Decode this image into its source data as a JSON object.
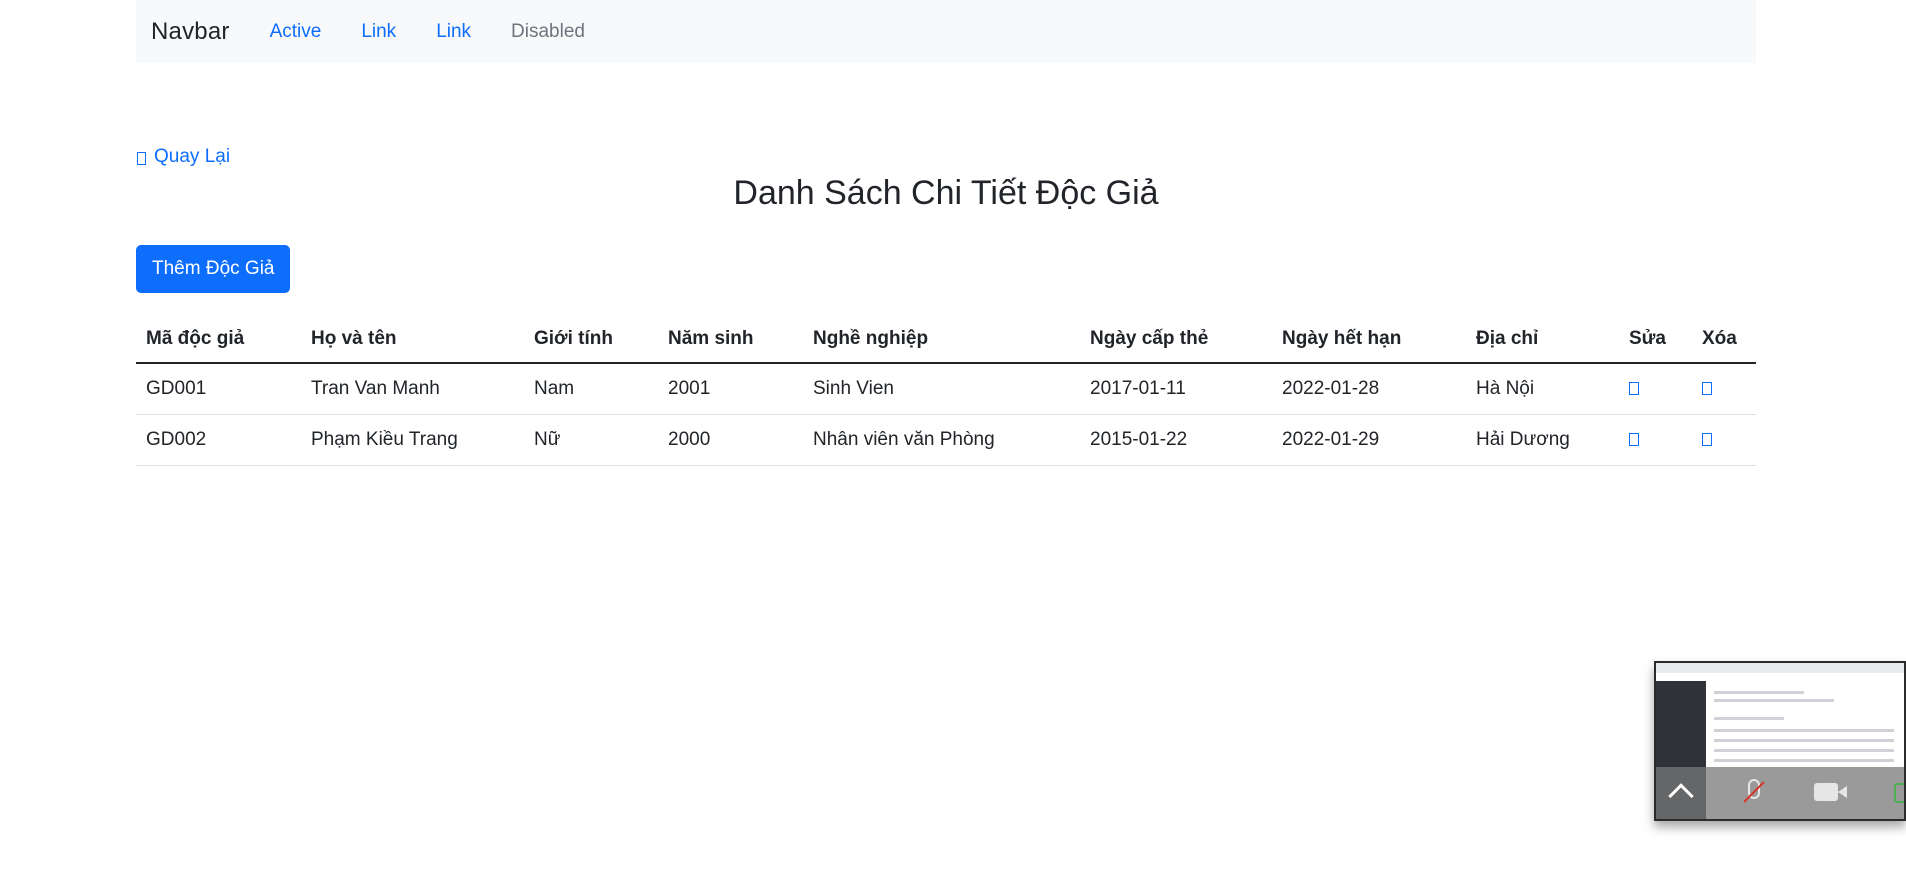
{
  "navbar": {
    "brand": "Navbar",
    "links": [
      {
        "label": "Active"
      },
      {
        "label": "Link"
      },
      {
        "label": "Link"
      },
      {
        "label": "Disabled"
      }
    ]
  },
  "back_link": {
    "label": "Quay Lại",
    "icon": "arrow-left-icon"
  },
  "page_title": "Danh Sách Chi Tiết Độc Giả",
  "add_button": {
    "label": "Thêm Độc Giả"
  },
  "table": {
    "headers": [
      "Mã độc giả",
      "Họ và tên",
      "Giới tính",
      "Năm sinh",
      "Nghề nghiệp",
      "Ngày cấp thẻ",
      "Ngày hết hạn",
      "Địa chỉ",
      "Sửa",
      "Xóa"
    ],
    "rows": [
      {
        "id": "GD001",
        "name": "Tran Van Manh",
        "gender": "Nam",
        "birth_year": "2001",
        "occupation": "Sinh Vien",
        "issue_date": "2017-01-11",
        "expiry_date": "2022-01-28",
        "address": "Hà Nội",
        "edit_icon": "edit-icon",
        "delete_icon": "delete-icon"
      },
      {
        "id": "GD002",
        "name": "Phạm Kiều Trang",
        "gender": "Nữ",
        "birth_year": "2000",
        "occupation": "Nhân viên văn Phòng",
        "issue_date": "2015-01-22",
        "expiry_date": "2022-01-29",
        "address": "Hải Dương",
        "edit_icon": "edit-icon",
        "delete_icon": "delete-icon"
      }
    ]
  },
  "video_overlay": {
    "controls": [
      "chevron-up-icon",
      "mic-muted-icon",
      "camera-icon",
      "share-screen-icon"
    ]
  },
  "colors": {
    "primary": "#0d6efd",
    "navbar_bg": "#f8f9fa",
    "text": "#212529",
    "disabled": "#6c757d"
  }
}
